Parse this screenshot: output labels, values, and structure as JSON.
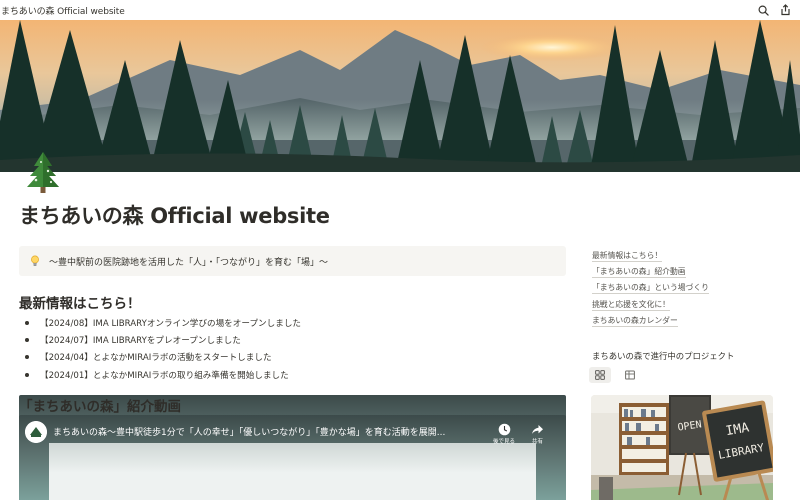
{
  "window": {
    "title": "まちあいの森 Official website"
  },
  "icons": {
    "search": "search-icon",
    "share": "share-icon",
    "page": "evergreen-tree-icon",
    "callout": "lightbulb-icon",
    "gallery_view": "gallery-grid-icon",
    "table_view": "table-icon"
  },
  "page": {
    "title": "まちあいの森 Official website",
    "callout": "〜豊中駅前の医院跡地を活用した「人」・「つながり」を育む「場」〜"
  },
  "news": {
    "heading": "最新情報はこちら！",
    "items": [
      "【2024/08】IMA LIBRARYオンライン学びの場をオープンしました",
      "【2024/07】IMA LIBRARYをプレオープンしました",
      "【2024/04】とよなかMIRAIラボの活動をスタートしました",
      "【2024/01】とよなかMIRAIラボの取り組み準備を開始しました"
    ]
  },
  "video": {
    "heading": "「まちあいの森」紹介動画",
    "title": "まちあいの森〜豊中駅徒歩1分で「人の幸せ」「優しいつながり」「豊かな場」を育む活動を展開...",
    "watch_later_label": "後で見る",
    "share_label": "共有"
  },
  "toc": [
    "最新情報はこちら！",
    "「まちあいの森」紹介動画",
    "「まちあいの森」という場づくり",
    "挑戦と応援を文化に！",
    "まちあいの森カレンダー"
  ],
  "projects": {
    "heading": "まちあいの森で進行中のプロジェクト",
    "card_sign_text": [
      "IMA",
      "LIBRARY"
    ],
    "card_open_text": "OPEN"
  },
  "colors": {
    "text": "#37352f",
    "callout_bg": "#f6f5f2",
    "link_underline": "#d3d1cb",
    "sky_top": "#f2a65e",
    "forest": "#1f3a33"
  }
}
